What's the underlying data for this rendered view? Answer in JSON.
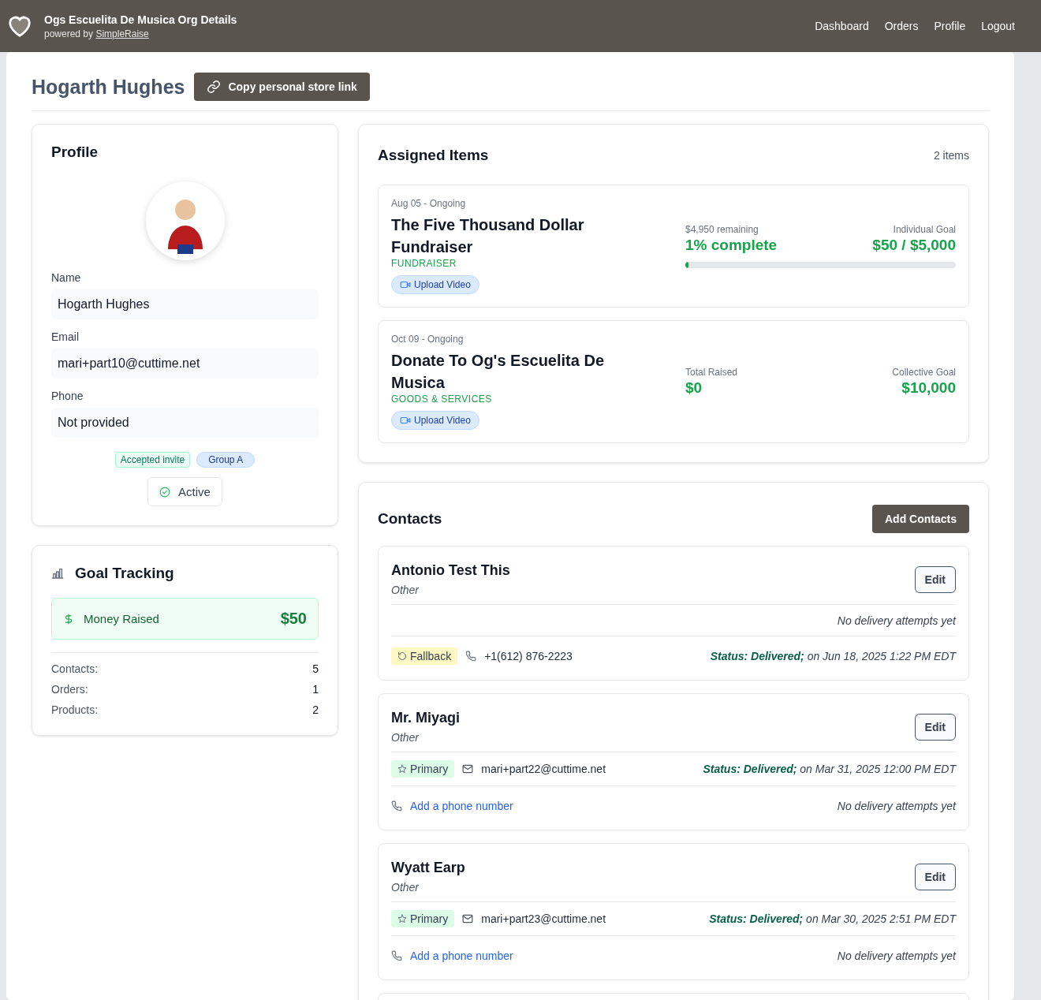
{
  "header": {
    "title": "Ogs Escuelita De Musica Org Details",
    "powered_by": "powered by",
    "brand_link": "SimpleRaise",
    "nav": [
      "Dashboard",
      "Orders",
      "Profile",
      "Logout"
    ]
  },
  "page": {
    "title": "Hogarth Hughes",
    "copy_button": "Copy personal store link"
  },
  "profile": {
    "heading": "Profile",
    "fields": [
      {
        "label": "Name",
        "value": "Hogarth Hughes"
      },
      {
        "label": "Email",
        "value": "mari+part10@cuttime.net"
      },
      {
        "label": "Phone",
        "value": "Not provided"
      }
    ],
    "tags": [
      {
        "label": "Accepted invite",
        "kind": "success"
      },
      {
        "label": "Group A",
        "kind": "group"
      }
    ],
    "status": {
      "label": "Active",
      "active": true
    }
  },
  "goal_tracking": {
    "heading": "Goal Tracking",
    "money_label": "Money Raised",
    "money_value": "$50",
    "stats": [
      {
        "label": "Contacts:",
        "value": "5"
      },
      {
        "label": "Orders:",
        "value": "1"
      },
      {
        "label": "Products:",
        "value": "2"
      }
    ]
  },
  "assigned_items": {
    "heading": "Assigned Items",
    "count": "2 items",
    "items": [
      {
        "kind": "individual",
        "dates": "Aug 05 - Ongoing",
        "title": "The Five Thousand Dollar Fundraiser",
        "type": "FUNDRAISER",
        "button": "Upload Video",
        "left_caption": "$4,950 remaining",
        "left_value": "1% complete",
        "right_caption": "Individual Goal",
        "right_value": "$50 / $5,000",
        "level": 0.01
      },
      {
        "kind": "collective",
        "dates": "Oct 09 - Ongoing",
        "title": "Donate To Og's Escuelita De Musica",
        "type": "GOODS & SERVICES",
        "button": "Upload Video",
        "left_caption": "Total Raised",
        "left_value": "$0",
        "right_caption": "Collective Goal",
        "right_value": "$10,000"
      }
    ]
  },
  "contacts": {
    "heading": "Contacts",
    "add_button": "Add Contacts",
    "items": [
      {
        "name": "Antonio Test This",
        "relation": "Other",
        "edit": "Edit",
        "rows": [
          {
            "kind": "note",
            "note": "No delivery attempts yet"
          },
          {
            "kind": "phone",
            "tag": {
              "label": "Fallback",
              "kind": "fallback"
            },
            "value": "+1(612) 876-2223",
            "status": "**Status: Delivered;** on Jun 18, 2025 1:22 PM EDT"
          }
        ]
      },
      {
        "name": "Mr. Miyagi",
        "relation": "Other",
        "edit": "Edit",
        "rows": [
          {
            "kind": "email",
            "tag": {
              "label": "Primary",
              "kind": "primary"
            },
            "value": "mari+part22@cuttime.net",
            "status": "**Status: Delivered;** on Mar 31, 2025 12:00 PM EDT"
          },
          {
            "kind": "phone",
            "link": "Add a phone number",
            "note": "No delivery attempts yet"
          }
        ]
      },
      {
        "name": "Wyatt Earp",
        "relation": "Other",
        "edit": "Edit",
        "rows": [
          {
            "kind": "email",
            "tag": {
              "label": "Primary",
              "kind": "primary"
            },
            "value": "mari+part23@cuttime.net",
            "status": "**Status: Delivered;** on Mar 30, 2025 2:51 PM EDT"
          },
          {
            "kind": "phone",
            "link": "Add a phone number",
            "note": "No delivery attempts yet"
          }
        ]
      },
      {
        "kind": "cut"
      }
    ]
  }
}
